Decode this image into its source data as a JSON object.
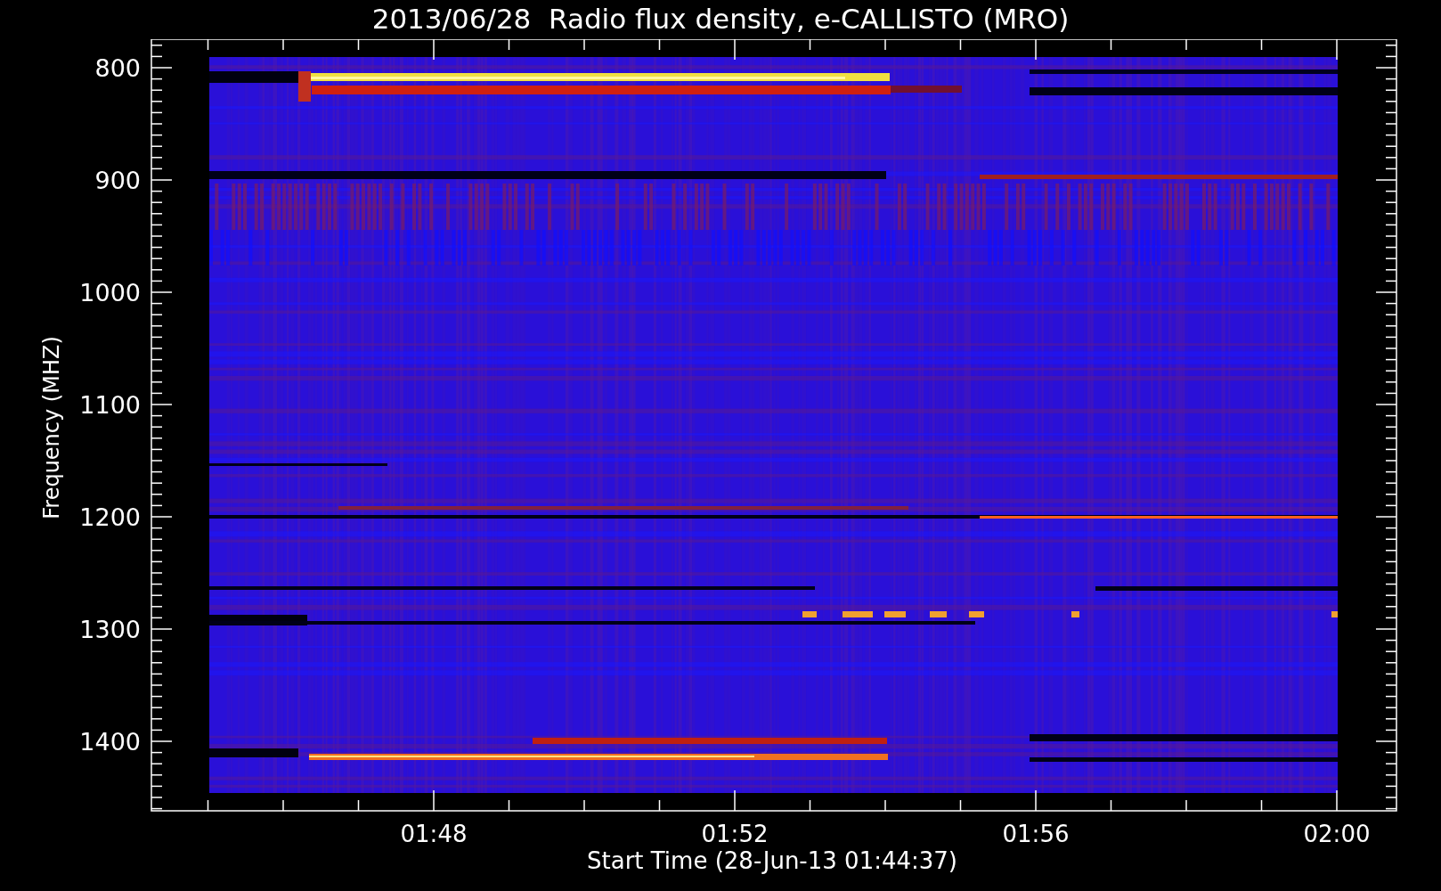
{
  "title": "2013/06/28  Radio flux density, e-CALLISTO (MRO)",
  "y_axis": {
    "label": "Frequency (MHZ)",
    "ticks": [
      "800",
      "900",
      "1000",
      "1100",
      "1200",
      "1300",
      "1400"
    ]
  },
  "x_axis": {
    "label": "Start Time (28-Jun-13 01:44:37)",
    "ticks": [
      "01:48",
      "01:52",
      "01:56",
      "02:00"
    ]
  }
}
